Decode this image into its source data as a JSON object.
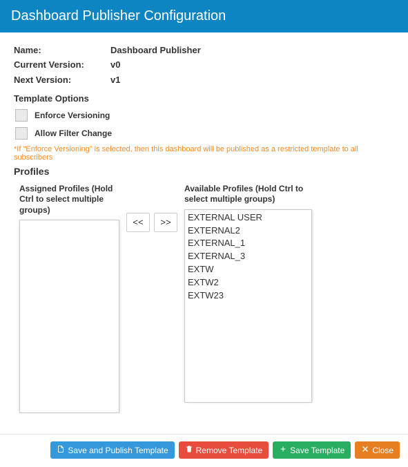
{
  "header": {
    "title": "Dashboard Publisher Configuration"
  },
  "fields": {
    "name_label": "Name:",
    "name_value": "Dashboard Publisher",
    "current_version_label": "Current Version:",
    "current_version_value": "v0",
    "next_version_label": "Next Version:",
    "next_version_value": "v1"
  },
  "template_options": {
    "title": "Template Options",
    "enforce_versioning_label": "Enforce Versioning",
    "allow_filter_change_label": "Allow Filter Change",
    "hint": "*If \"Enforce Versioning\" is selected, then this dashboard will be published as a restricted template to all subscribers"
  },
  "profiles": {
    "title": "Profiles",
    "assigned_label": "Assigned Profiles (Hold Ctrl to select multiple groups)",
    "available_label": "Available Profiles (Hold Ctrl to select multiple groups)",
    "move_left_label": "<<",
    "move_right_label": ">>",
    "assigned_items": [],
    "available_items": [
      "EXTERNAL USER",
      "EXTERNAL2",
      "EXTERNAL_1",
      "EXTERNAL_3",
      "EXTW",
      "EXTW2",
      "EXTW23"
    ]
  },
  "footer": {
    "save_publish_label": "Save and Publish Template",
    "remove_label": "Remove Template",
    "save_template_label": "Save Template",
    "close_label": "Close"
  }
}
